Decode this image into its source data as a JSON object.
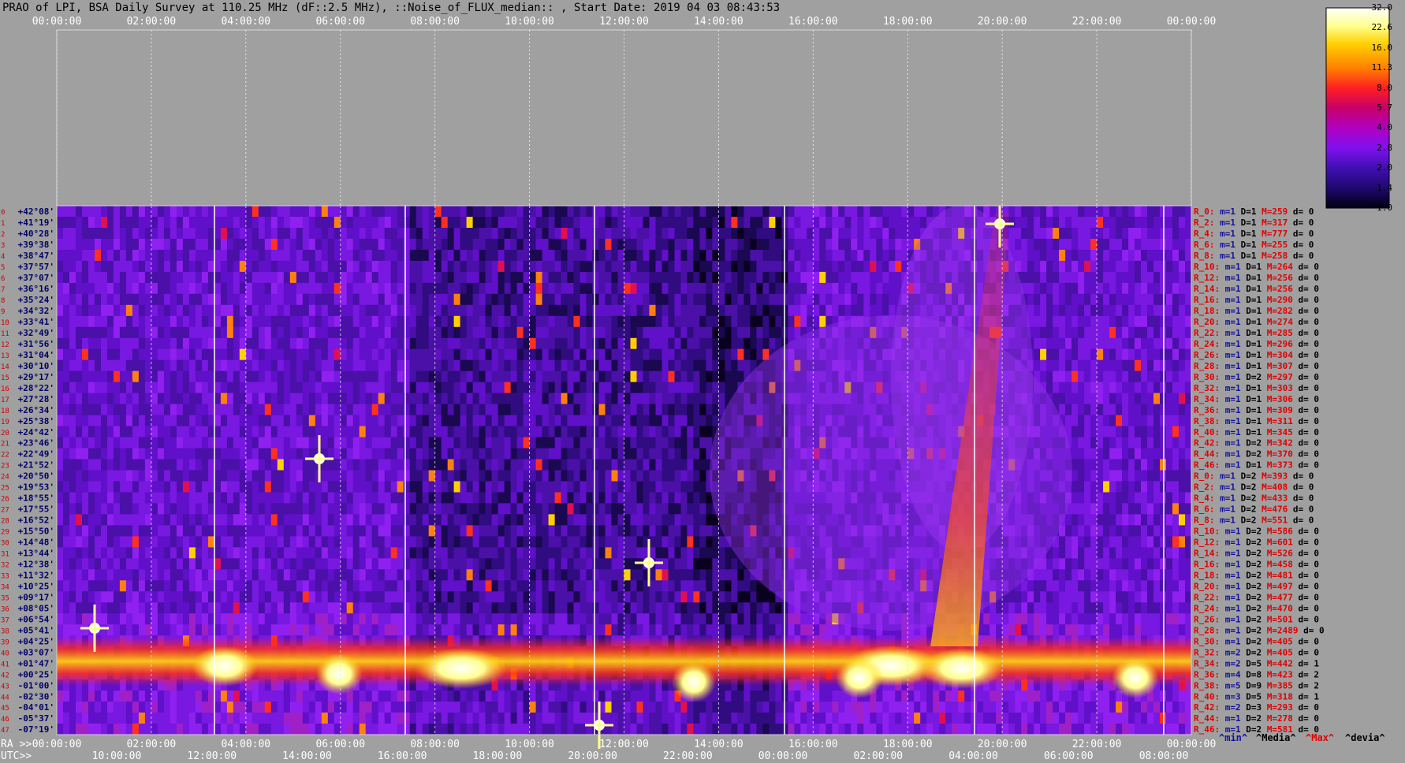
{
  "title": "PRAO of LPI, BSA Daily Survey at 110.25 MHz (dF::2.5 MHz), ::Noise_of_FLUX_median:: , Start Date: 2019 04 03 08:43:53",
  "chart_data": {
    "type": "heatmap",
    "top_time_ticks": [
      "00:00:00",
      "02:00:00",
      "04:00:00",
      "06:00:00",
      "08:00:00",
      "10:00:00",
      "12:00:00",
      "14:00:00",
      "16:00:00",
      "18:00:00",
      "20:00:00",
      "22:00:00",
      "00:00:00"
    ],
    "ra_axis_label": "RA >>",
    "ra_ticks": [
      "00:00:00",
      "02:00:00",
      "04:00:00",
      "06:00:00",
      "08:00:00",
      "10:00:00",
      "12:00:00",
      "14:00:00",
      "16:00:00",
      "18:00:00",
      "20:00:00",
      "22:00:00",
      "00:00:00"
    ],
    "utc_axis_label": "UTC>>",
    "utc_ticks": [
      "10:00:00",
      "12:00:00",
      "14:00:00",
      "16:00:00",
      "18:00:00",
      "20:00:00",
      "22:00:00",
      "00:00:00",
      "02:00:00",
      "04:00:00",
      "06:00:00",
      "08:00:00"
    ],
    "declinations": [
      "+42°08'",
      "+41°19'",
      "+40°28'",
      "+39°38'",
      "+38°47'",
      "+37°57'",
      "+37°07'",
      "+36°16'",
      "+35°24'",
      "+34°32'",
      "+33°41'",
      "+32°49'",
      "+31°56'",
      "+31°04'",
      "+30°10'",
      "+29°17'",
      "+28°22'",
      "+27°28'",
      "+26°34'",
      "+25°38'",
      "+24°42'",
      "+23°46'",
      "+22°49'",
      "+21°52'",
      "+20°50'",
      "+19°53'",
      "+18°55'",
      "+17°55'",
      "+16°52'",
      "+15°50'",
      "+14°48'",
      "+13°44'",
      "+12°38'",
      "+11°32'",
      "+10°25'",
      "+09°17'",
      "+08°05'",
      "+06°54'",
      "+05°41'",
      "+04°25'",
      "+03°07'",
      "+01°47'",
      "+00°25'",
      "-01°00'",
      "-02°30'",
      "-04°01'",
      "-05°37'",
      "-07°19'"
    ],
    "colorbar": {
      "ticks": [
        "32.0",
        "22.6",
        "16.0",
        "11.3",
        "8.0",
        "5.7",
        "4.0",
        "2.8",
        "2.0",
        "1.4",
        "1.0"
      ],
      "colors": [
        "#ffffff",
        "#ffff90",
        "#ffd000",
        "#ff8000",
        "#ff2020",
        "#c8006a",
        "#b000c0",
        "#8010f0",
        "#4010b0",
        "#200870",
        "#000010"
      ]
    },
    "row_stats": [
      {
        "r": "R_0:",
        "m": "1",
        "d": "1",
        "M": "259",
        "dev": "0"
      },
      {
        "r": "R_2:",
        "m": "1",
        "d": "1",
        "M": "317",
        "dev": "0"
      },
      {
        "r": "R_4:",
        "m": "1",
        "d": "1",
        "M": "777",
        "dev": "0"
      },
      {
        "r": "R_6:",
        "m": "1",
        "d": "1",
        "M": "255",
        "dev": "0"
      },
      {
        "r": "R_8:",
        "m": "1",
        "d": "1",
        "M": "258",
        "dev": "0"
      },
      {
        "r": "R_10:",
        "m": "1",
        "d": "1",
        "M": "264",
        "dev": "0"
      },
      {
        "r": "R_12:",
        "m": "1",
        "d": "1",
        "M": "256",
        "dev": "0"
      },
      {
        "r": "R_14:",
        "m": "1",
        "d": "1",
        "M": "256",
        "dev": "0"
      },
      {
        "r": "R_16:",
        "m": "1",
        "d": "1",
        "M": "290",
        "dev": "0"
      },
      {
        "r": "R_18:",
        "m": "1",
        "d": "1",
        "M": "282",
        "dev": "0"
      },
      {
        "r": "R_20:",
        "m": "1",
        "d": "1",
        "M": "274",
        "dev": "0"
      },
      {
        "r": "R_22:",
        "m": "1",
        "d": "1",
        "M": "285",
        "dev": "0"
      },
      {
        "r": "R_24:",
        "m": "1",
        "d": "1",
        "M": "296",
        "dev": "0"
      },
      {
        "r": "R_26:",
        "m": "1",
        "d": "1",
        "M": "304",
        "dev": "0"
      },
      {
        "r": "R_28:",
        "m": "1",
        "d": "1",
        "M": "307",
        "dev": "0"
      },
      {
        "r": "R_30:",
        "m": "1",
        "d": "2",
        "M": "297",
        "dev": "0"
      },
      {
        "r": "R_32:",
        "m": "1",
        "d": "1",
        "M": "303",
        "dev": "0"
      },
      {
        "r": "R_34:",
        "m": "1",
        "d": "1",
        "M": "306",
        "dev": "0"
      },
      {
        "r": "R_36:",
        "m": "1",
        "d": "1",
        "M": "309",
        "dev": "0"
      },
      {
        "r": "R_38:",
        "m": "1",
        "d": "1",
        "M": "311",
        "dev": "0"
      },
      {
        "r": "R_40:",
        "m": "1",
        "d": "1",
        "M": "345",
        "dev": "0"
      },
      {
        "r": "R_42:",
        "m": "1",
        "d": "2",
        "M": "342",
        "dev": "0"
      },
      {
        "r": "R_44:",
        "m": "1",
        "d": "2",
        "M": "370",
        "dev": "0"
      },
      {
        "r": "R_46:",
        "m": "1",
        "d": "1",
        "M": "373",
        "dev": "0"
      },
      {
        "r": "R_0:",
        "m": "1",
        "d": "2",
        "M": "393",
        "dev": "0"
      },
      {
        "r": "R_2:",
        "m": "1",
        "d": "2",
        "M": "408",
        "dev": "0"
      },
      {
        "r": "R_4:",
        "m": "1",
        "d": "2",
        "M": "433",
        "dev": "0"
      },
      {
        "r": "R_6:",
        "m": "1",
        "d": "2",
        "M": "476",
        "dev": "0"
      },
      {
        "r": "R_8:",
        "m": "1",
        "d": "2",
        "M": "551",
        "dev": "0"
      },
      {
        "r": "R_10:",
        "m": "1",
        "d": "2",
        "M": "586",
        "dev": "0"
      },
      {
        "r": "R_12:",
        "m": "1",
        "d": "2",
        "M": "601",
        "dev": "0"
      },
      {
        "r": "R_14:",
        "m": "1",
        "d": "2",
        "M": "526",
        "dev": "0"
      },
      {
        "r": "R_16:",
        "m": "1",
        "d": "2",
        "M": "458",
        "dev": "0"
      },
      {
        "r": "R_18:",
        "m": "1",
        "d": "2",
        "M": "481",
        "dev": "0"
      },
      {
        "r": "R_20:",
        "m": "1",
        "d": "2",
        "M": "497",
        "dev": "0"
      },
      {
        "r": "R_22:",
        "m": "1",
        "d": "2",
        "M": "477",
        "dev": "0"
      },
      {
        "r": "R_24:",
        "m": "1",
        "d": "2",
        "M": "470",
        "dev": "0"
      },
      {
        "r": "R_26:",
        "m": "1",
        "d": "2",
        "M": "501",
        "dev": "0"
      },
      {
        "r": "R_28:",
        "m": "1",
        "d": "2",
        "M": "2489",
        "dev": "0"
      },
      {
        "r": "R_30:",
        "m": "1",
        "d": "2",
        "M": "405",
        "dev": "0"
      },
      {
        "r": "R_32:",
        "m": "2",
        "d": "2",
        "M": "405",
        "dev": "0"
      },
      {
        "r": "R_34:",
        "m": "2",
        "d": "5",
        "M": "442",
        "dev": "1"
      },
      {
        "r": "R_36:",
        "m": "4",
        "d": "8",
        "M": "423",
        "dev": "2"
      },
      {
        "r": "R_38:",
        "m": "5",
        "d": "9",
        "M": "385",
        "dev": "2"
      },
      {
        "r": "R_40:",
        "m": "3",
        "d": "5",
        "M": "318",
        "dev": "1"
      },
      {
        "r": "R_42:",
        "m": "2",
        "d": "3",
        "M": "293",
        "dev": "0"
      },
      {
        "r": "R_44:",
        "m": "1",
        "d": "2",
        "M": "278",
        "dev": "0"
      },
      {
        "r": "R_46:",
        "m": "1",
        "d": "2",
        "M": "581",
        "dev": "0"
      }
    ],
    "row_stat_labels": {
      "m": "m=",
      "d": "D=",
      "M": "M=",
      "dev": "d="
    },
    "legend": [
      {
        "text": "^min^",
        "color": "#1010a0"
      },
      {
        "text": "^Media^",
        "color": "#000000"
      },
      {
        "text": "^Max^",
        "color": "#e00000"
      },
      {
        "text": "^devia^",
        "color": "#000000"
      }
    ]
  }
}
